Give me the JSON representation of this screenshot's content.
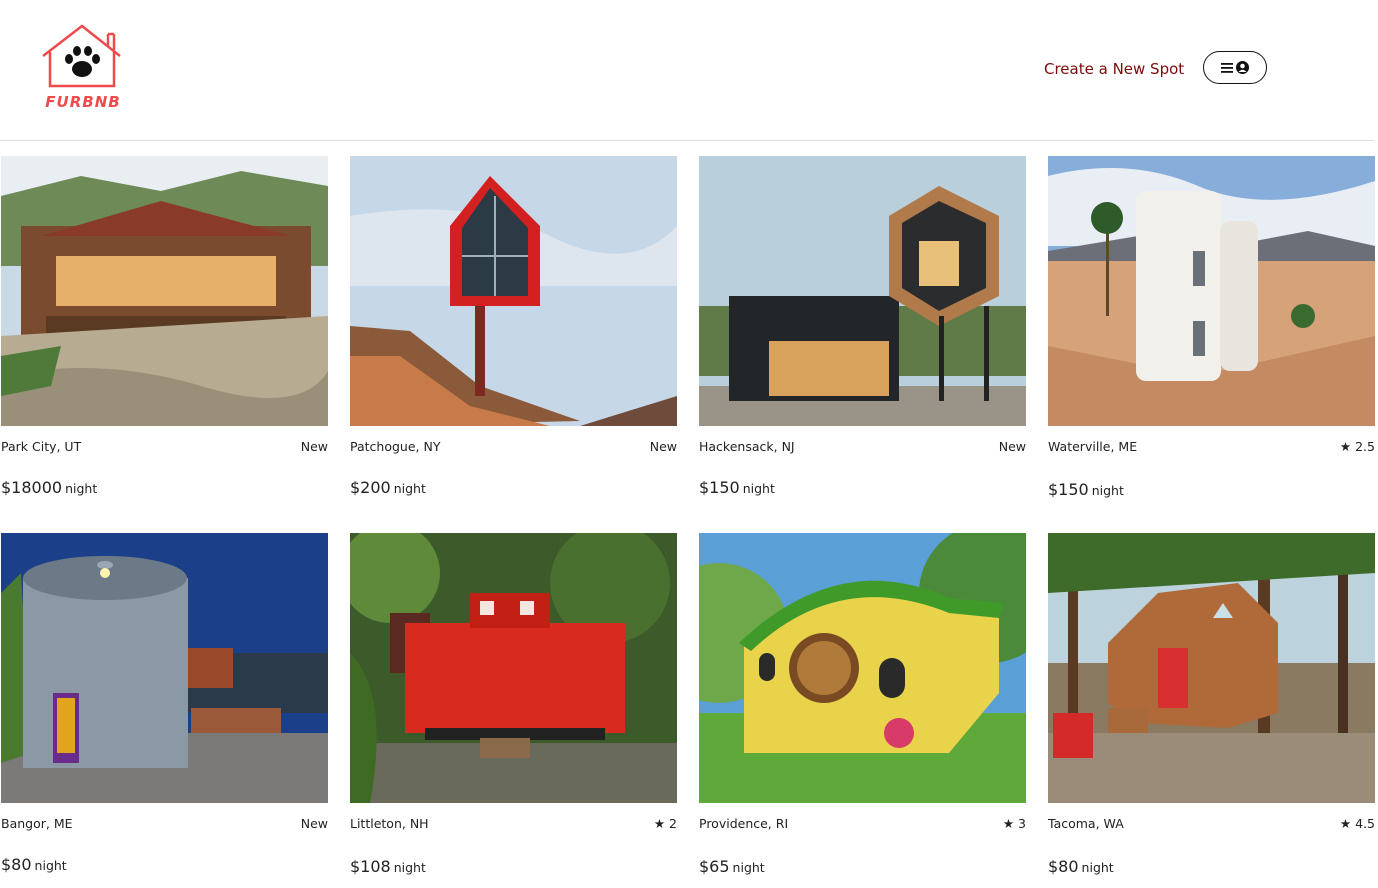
{
  "header": {
    "logo_text": "FURBNB",
    "create_spot_label": "Create a New Spot",
    "menu_icon": "hamburger-icon",
    "user_icon": "user-circle-icon"
  },
  "colors": {
    "brand": "#ef4a4d",
    "link": "#7a0c0c"
  },
  "spots": [
    {
      "location": "Park City, UT",
      "rating": "New",
      "price": "$18000",
      "unit": "night"
    },
    {
      "location": "Patchogue, NY",
      "rating": "New",
      "price": "$200",
      "unit": "night"
    },
    {
      "location": "Hackensack, NJ",
      "rating": "New",
      "price": "$150",
      "unit": "night"
    },
    {
      "location": "Waterville, ME",
      "rating": "2.5",
      "price": "$150",
      "unit": "night"
    },
    {
      "location": "Bangor, ME",
      "rating": "New",
      "price": "$80",
      "unit": "night"
    },
    {
      "location": "Littleton, NH",
      "rating": "2",
      "price": "$108",
      "unit": "night"
    },
    {
      "location": "Providence, RI",
      "rating": "3",
      "price": "$65",
      "unit": "night"
    },
    {
      "location": "Tacoma, WA",
      "rating": "4.5",
      "price": "$80",
      "unit": "night"
    }
  ]
}
